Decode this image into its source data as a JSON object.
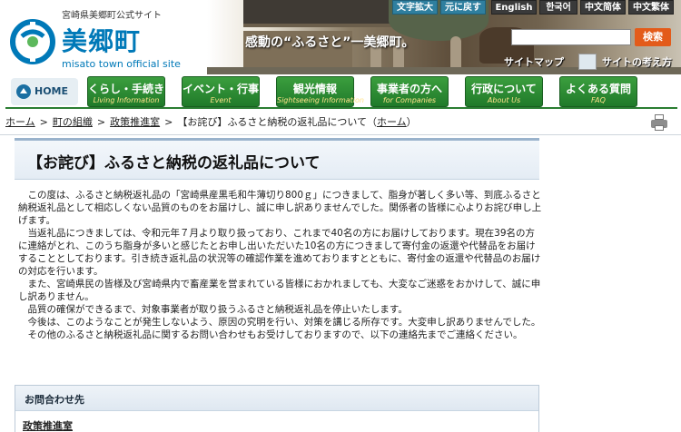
{
  "header": {
    "site_sub": "宮崎県美郷町公式サイト",
    "site_name": "美郷町",
    "site_en": "misato town official site",
    "hero_text": "感動の“ふるさと”一美郷町。",
    "tools": [
      "文字拡大",
      "元に戻す",
      "English",
      "한국어",
      "中文简体",
      "中文繁体"
    ],
    "search_button": "検索",
    "search_placeholder": "",
    "sitemap": "サイトマップ",
    "policy": "サイトの考え方"
  },
  "nav": {
    "home": "HOME",
    "items": [
      {
        "jp": "くらし・手続き",
        "en": "Living Information"
      },
      {
        "jp": "イベント・行事",
        "en": "Event"
      },
      {
        "jp": "観光情報",
        "en": "Sightseeing Information"
      },
      {
        "jp": "事業者の方へ",
        "en": "for Companies"
      },
      {
        "jp": "行政について",
        "en": "About Us"
      },
      {
        "jp": "よくある質問",
        "en": "FAQ"
      }
    ]
  },
  "breadcrumb": {
    "home": "ホーム",
    "org": "町の組織",
    "dept": "政策推進室",
    "current": "【お詫び】ふるさと納税の返礼品について",
    "return_open": "（",
    "return_link": "ホーム",
    "return_close": "）"
  },
  "article": {
    "title": "【お詫び】ふるさと納税の返礼品について",
    "paragraphs": [
      "この度は、ふるさと納税返礼品の「宮崎県産黒毛和牛薄切り800ｇ」につきまして、脂身が著しく多い等、到底ふるさと納税返礼品として相応しくない品質のものをお届けし、誠に申し訳ありませんでした。関係者の皆様に心よりお詫び申し上げます。",
      "当返礼品につきましては、令和元年７月より取り扱っており、これまで40名の方にお届けしております。現在39名の方に連絡がとれ、このうち脂身が多いと感じたとお申し出いただいた10名の方につきまして寄付金の返還や代替品をお届けすることとしております。引き続き返礼品の状況等の確認作業を進めておりますとともに、寄付金の返還や代替品のお届けの対応を行います。",
      "また、宮崎県民の皆様及び宮崎県内で畜産業を営まれている皆様におかれましても、大変なご迷惑をおかけして、誠に申し訳ありません。",
      "品質の確保ができるまで、対象事業者が取り扱うふるさと納税返礼品を停止いたします。",
      "今後は、このようなことが発生しないよう、原因の究明を行い、対策を講じる所存です。大変申し訳ありませんでした。",
      "その他のふるさと納税返礼品に関するお問い合わせもお受けしておりますので、以下の連絡先までご連絡ください。"
    ]
  },
  "contact": {
    "heading": "お問合わせ先",
    "department": "政策推進室"
  },
  "colors": {
    "brand_blue": "#0079b8",
    "nav_green": "#207a2a",
    "search_orange": "#e35b1a"
  }
}
